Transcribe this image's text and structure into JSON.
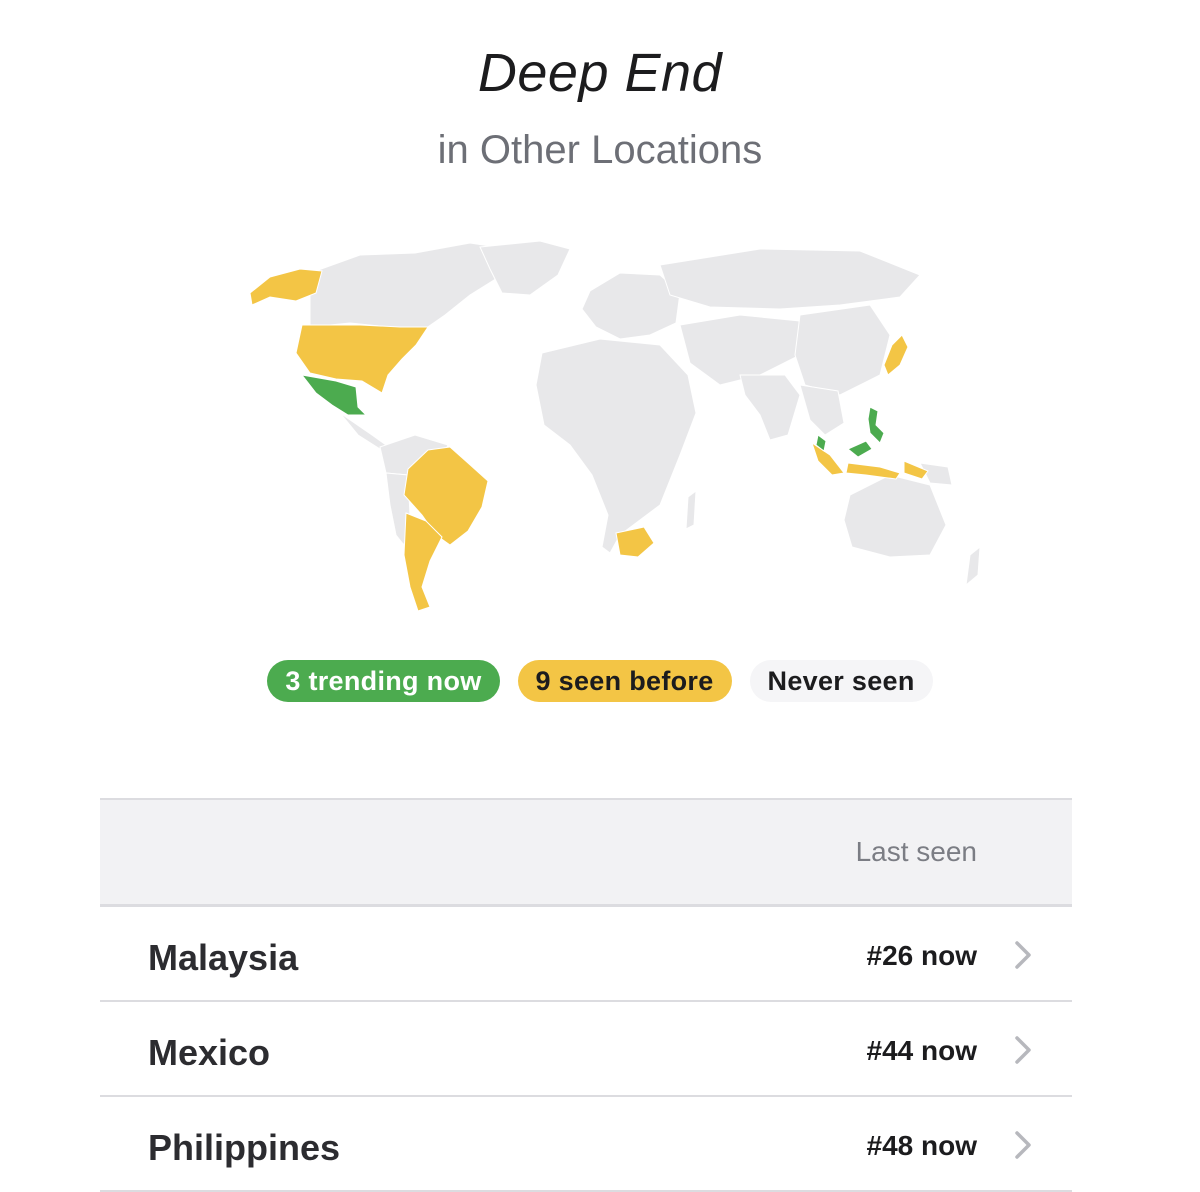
{
  "header": {
    "title": "Deep End",
    "subtitle": "in Other Locations"
  },
  "colors": {
    "trending": "#4cab4f",
    "seen_before": "#f3c545",
    "never_seen": "#e8e8ea"
  },
  "legend": {
    "trending": "3 trending now",
    "seen_before": "9 seen before",
    "never_seen": "Never seen"
  },
  "table": {
    "column_header": "Last seen",
    "rows": [
      {
        "country": "Malaysia",
        "last_seen": "#26 now",
        "icon": "chevron-right-icon"
      },
      {
        "country": "Mexico",
        "last_seen": "#44 now",
        "icon": "chevron-right-icon"
      },
      {
        "country": "Philippines",
        "last_seen": "#48 now",
        "icon": "chevron-right-icon"
      }
    ]
  }
}
